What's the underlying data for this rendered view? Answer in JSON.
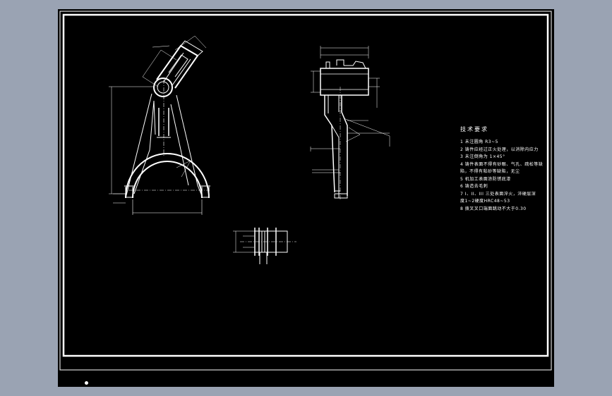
{
  "drawing": {
    "tech_title": "技术要求",
    "tech_notes": [
      "1  未注圆角 R3~5",
      "2  铸件应经过正火处理，以消除内应力",
      "3  未注倒角为 1×45°",
      "4  铸件表面不得有砂眼、气孔、疏松等缺",
      "陷，不得有粘砂等缺陷，无尘",
      "5  机加工表面涂防锈底漆",
      "6  铸造去毛刺",
      "7  I、II、III 三处表面淬火，淬硬层深",
      "度1~2硬度HRC48~53",
      "8  拨叉叉口端面跳动不大于0.30"
    ],
    "colors": {
      "background": "#000000",
      "line": "#ffffff",
      "outer": "#9aa3b3"
    }
  }
}
